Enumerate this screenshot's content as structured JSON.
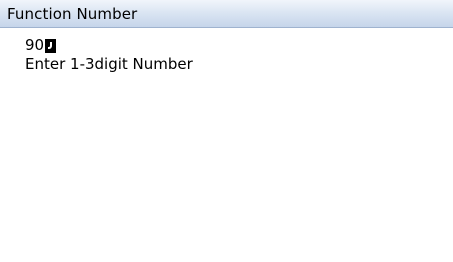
{
  "window": {
    "title": "Function Number"
  },
  "entry": {
    "value": "90",
    "cursor_icon": "text-cursor-icon",
    "hint": "Enter 1-3digit Number"
  },
  "colors": {
    "background": "#ffffff",
    "title_bar": "#d9e4f2",
    "text": "#000000"
  }
}
